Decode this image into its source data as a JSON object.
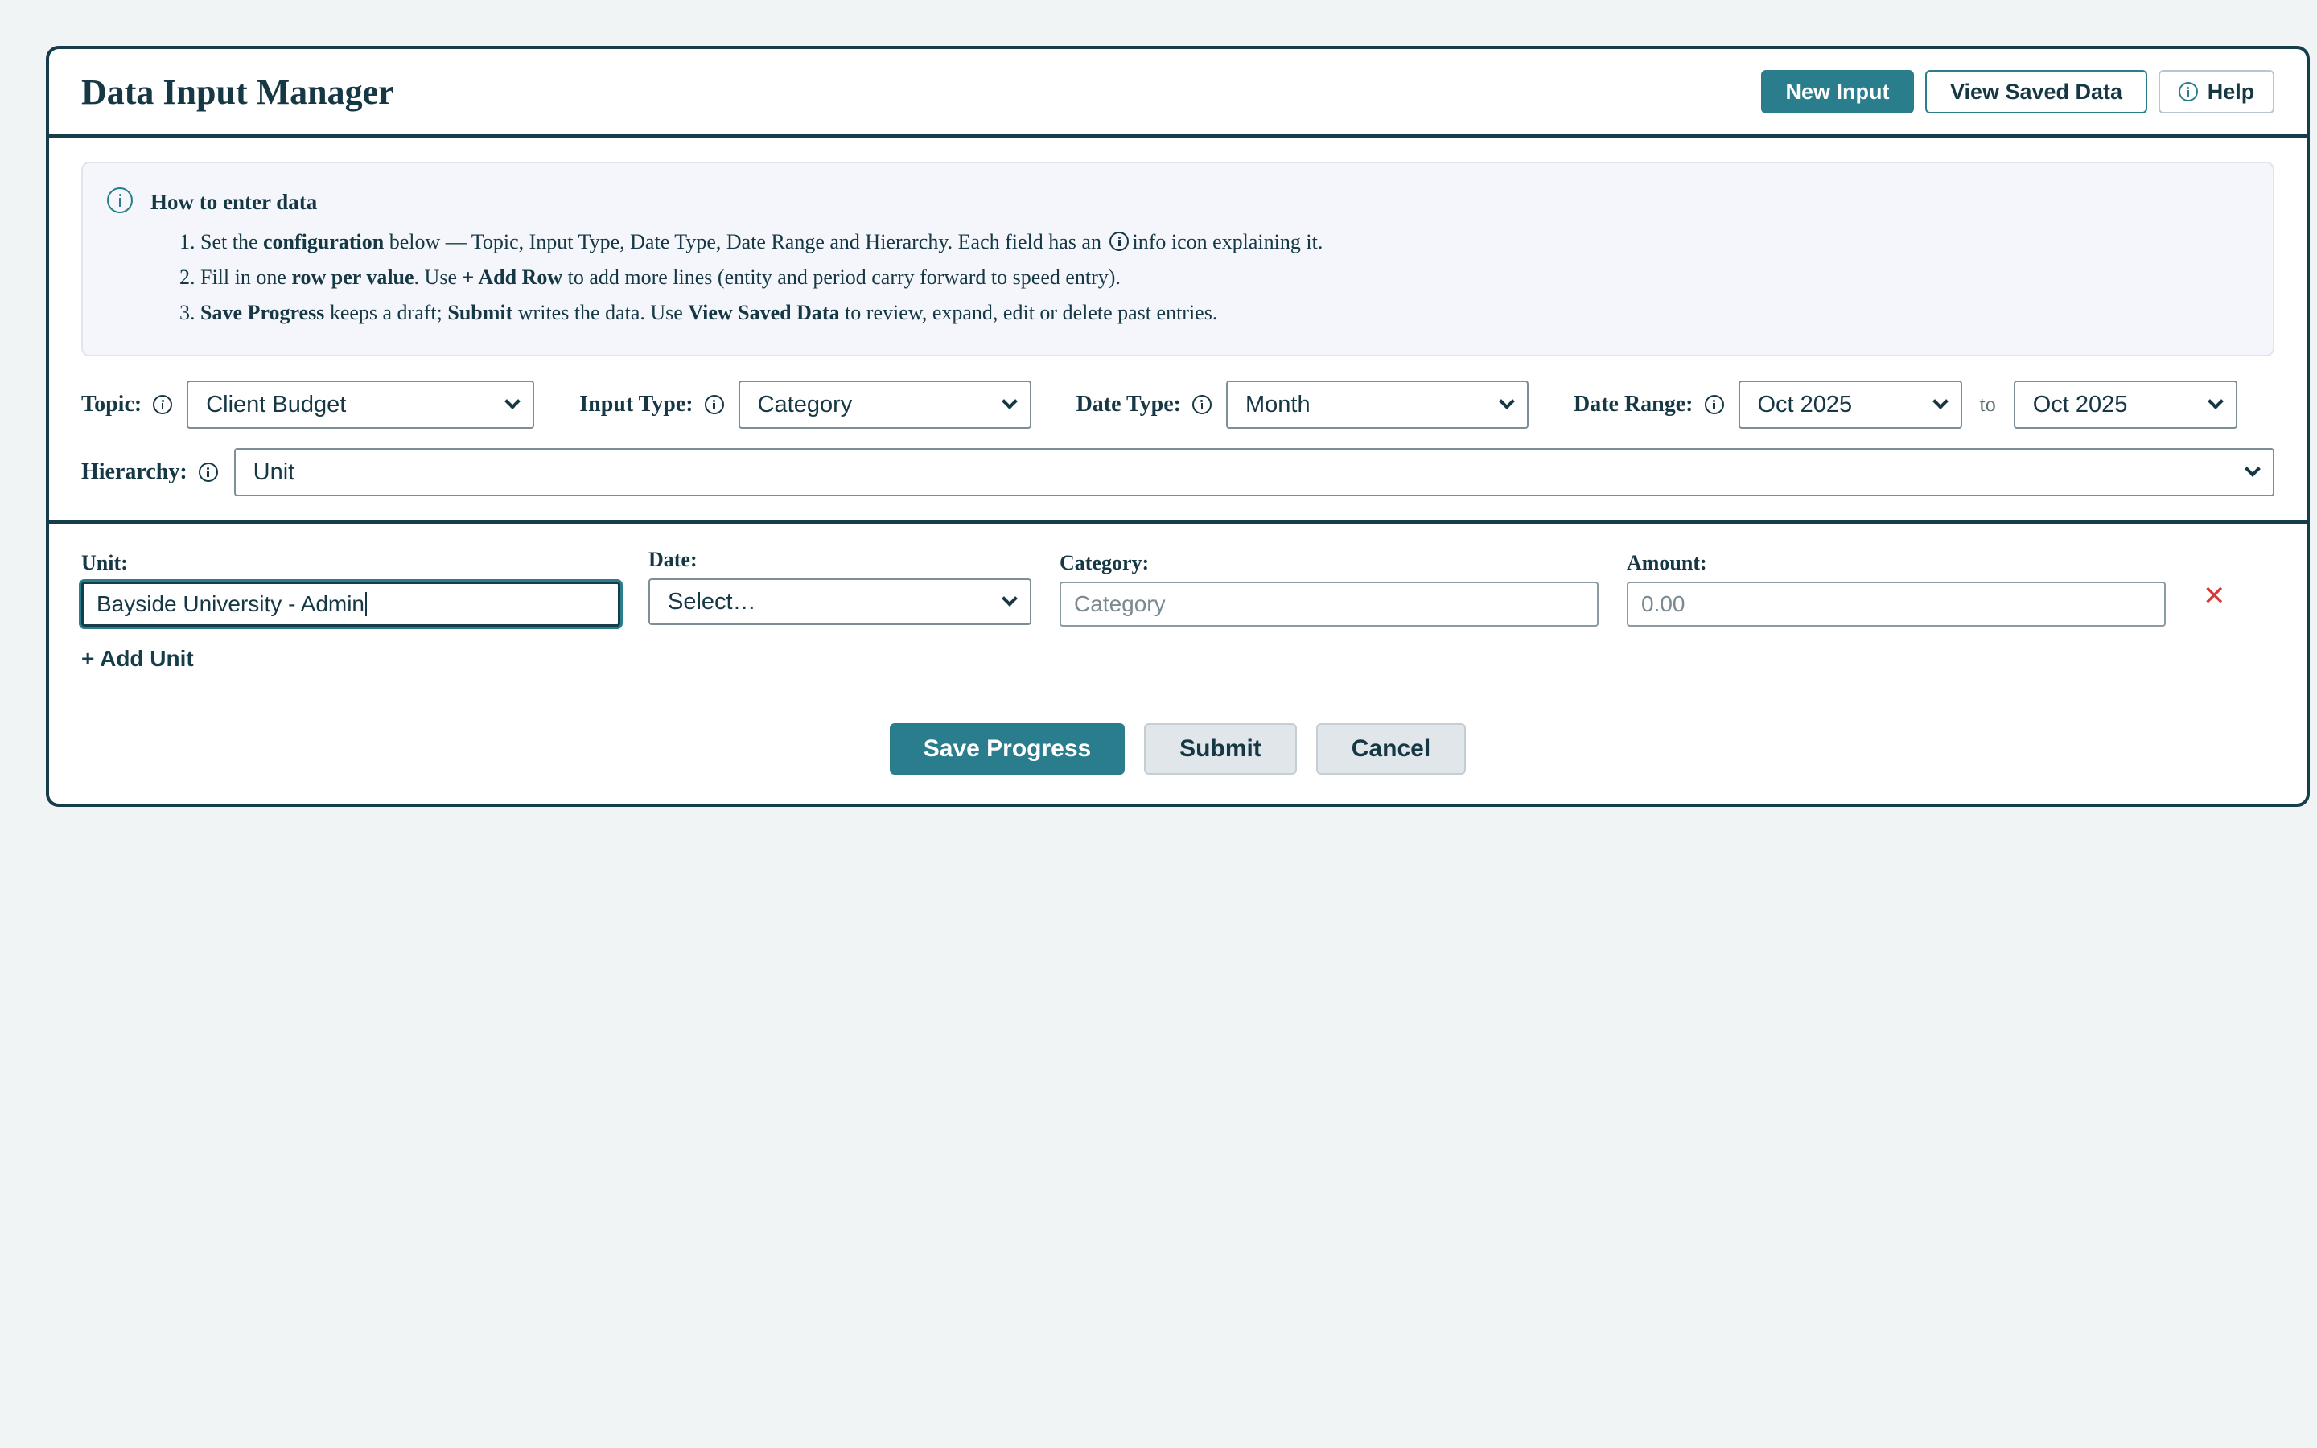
{
  "header": {
    "title": "Data Input Manager",
    "new_input_label": "New Input",
    "view_saved_label": "View Saved Data",
    "help_label": "Help"
  },
  "instructions": {
    "title": "How to enter data",
    "steps": [
      {
        "num": "1.",
        "parts": [
          "Set the ",
          "configuration",
          " below — Topic, Input Type, Date Type, Date Range and Hierarchy. Each field has an ",
          "info icon explaining it."
        ]
      },
      {
        "num": "2.",
        "parts": [
          "Fill in one ",
          "row per value",
          ". Use ",
          "+ Add Row",
          " to add more lines (entity and period carry forward to speed entry)."
        ]
      },
      {
        "num": "3.",
        "parts": [
          "Save Progress",
          " keeps a draft; ",
          "Submit",
          " writes the data. Use ",
          "View Saved Data",
          " to review, expand, edit or delete past entries."
        ]
      }
    ]
  },
  "config": {
    "topic_label": "Topic:",
    "topic_value": "Client Budget",
    "input_type_label": "Input Type:",
    "input_type_value": "Category",
    "date_type_label": "Date Type:",
    "date_type_value": "Month",
    "date_range_label": "Date Range:",
    "date_from": "Oct 2025",
    "to_text": "to",
    "date_to": "Oct 2025",
    "hierarchy_label": "Hierarchy:",
    "hierarchy_value": "Unit"
  },
  "entry": {
    "unit_label": "Unit:",
    "unit_value": "Bayside University - Admin",
    "date_label": "Date:",
    "date_value": "Select…",
    "category_label": "Category:",
    "category_placeholder": "Category",
    "amount_label": "Amount:",
    "amount_placeholder": "0.00",
    "remove_symbol": "✕",
    "add_unit_label": "+ Add Unit"
  },
  "actions": {
    "save_label": "Save Progress",
    "submit_label": "Submit",
    "cancel_label": "Cancel"
  },
  "icons": [
    "info-icon",
    "close-icon",
    "chevron-down-icon"
  ],
  "colors": {
    "accent": "#2a7d8c",
    "dark": "#163d4a",
    "danger": "#d63b3b"
  }
}
